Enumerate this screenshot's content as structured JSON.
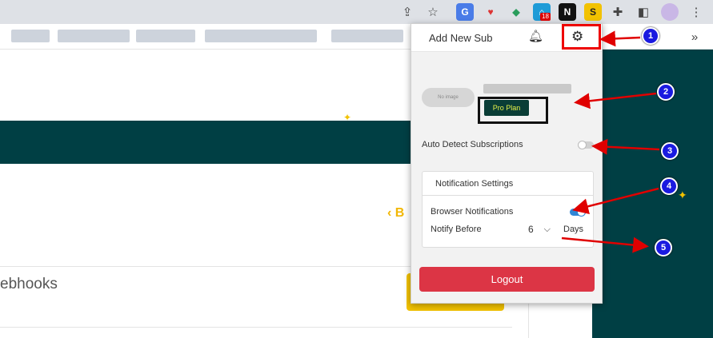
{
  "browser": {
    "extension_badge": "18",
    "ext_notion_glyph": "N",
    "ext_s_glyph": "S",
    "more_glyph": "»"
  },
  "page": {
    "partial_heading": "ebhooks",
    "back_link": "‹ B"
  },
  "popup": {
    "title": "Add New Sub",
    "avatar_placeholder": "No image",
    "plan_badge": "Pro Plan",
    "auto_detect_label": "Auto Detect Subscriptions",
    "auto_detect_enabled": false,
    "notification_settings": {
      "title": "Notification Settings",
      "browser_notifications_label": "Browser Notifications",
      "browser_notifications_enabled": true,
      "notify_before_label": "Notify Before",
      "notify_before_value": "6",
      "notify_before_unit": "Days"
    },
    "logout_label": "Logout"
  },
  "annotations": {
    "numbers": [
      "1",
      "2",
      "3",
      "4",
      "5"
    ],
    "arrow_color": "#e00000",
    "marker_color": "#1a1ae0"
  },
  "colors": {
    "teal": "#003f44",
    "logout": "#dc3545",
    "toggle_on": "#2f86d6",
    "pro_plan_bg": "#0a3d36",
    "accent_yellow": "#f2c200"
  }
}
